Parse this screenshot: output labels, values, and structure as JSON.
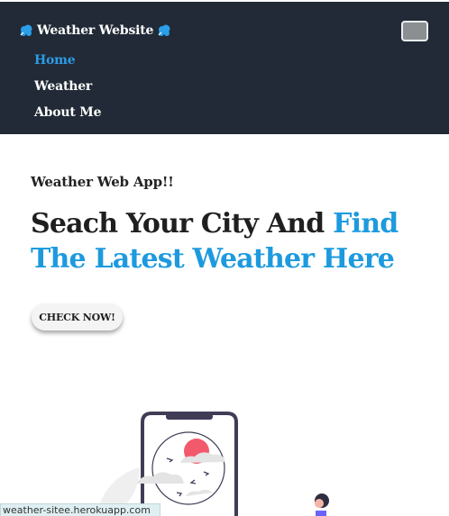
{
  "navbar": {
    "brand": "Weather Website",
    "brand_icon": "cloud-icon",
    "toggler_icon": "hamburger-icon",
    "links": [
      {
        "label": "Home",
        "active": true
      },
      {
        "label": "Weather",
        "active": false
      },
      {
        "label": "About Me",
        "active": false
      }
    ]
  },
  "hero": {
    "kicker": "Weather Web App!!",
    "headline_part1": "Seach Your City And ",
    "headline_accent": "Find The Latest Weather Here",
    "cta": "CHECK NOW!"
  },
  "status_bar": {
    "url": "weather-sitee.herokuapp.com"
  },
  "colors": {
    "navbar_bg": "#212a36",
    "accent": "#1d9ade",
    "active_link": "#2d9be6",
    "sun": "#f25a6b"
  }
}
